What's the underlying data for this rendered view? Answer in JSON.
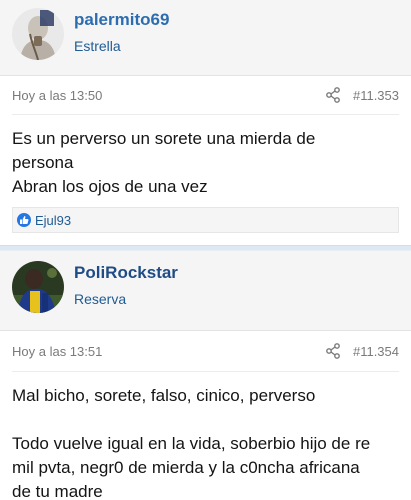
{
  "posts": [
    {
      "username": "palermito69",
      "user_title": "Estrella",
      "timestamp": "Hoy a las 13:50",
      "post_number": "#11.353",
      "message": "Es un perverso un sorete una mierda de\npersona\nAbran los ojos de una vez",
      "reactions": {
        "users": "Ejul93",
        "icon": "like-icon"
      }
    },
    {
      "username": "PoliRockstar",
      "user_title": "Reserva",
      "timestamp": "Hoy a las 13:51",
      "post_number": "#11.354",
      "message": "Mal bicho, sorete, falso, cinico, perverso\n\nTodo vuelve igual en la vida, soberbio hijo de re\nmil pvta, negr0 de mierda y la c0ncha africana\nde tu madre"
    }
  ],
  "colors": {
    "username": "#2c6db0",
    "user_title": "#1f5b94",
    "meta": "#7a7a7a",
    "like": "#2577e3",
    "separator": "#dde8f3"
  },
  "icons": {
    "share": "share-icon",
    "like": "like-icon"
  }
}
